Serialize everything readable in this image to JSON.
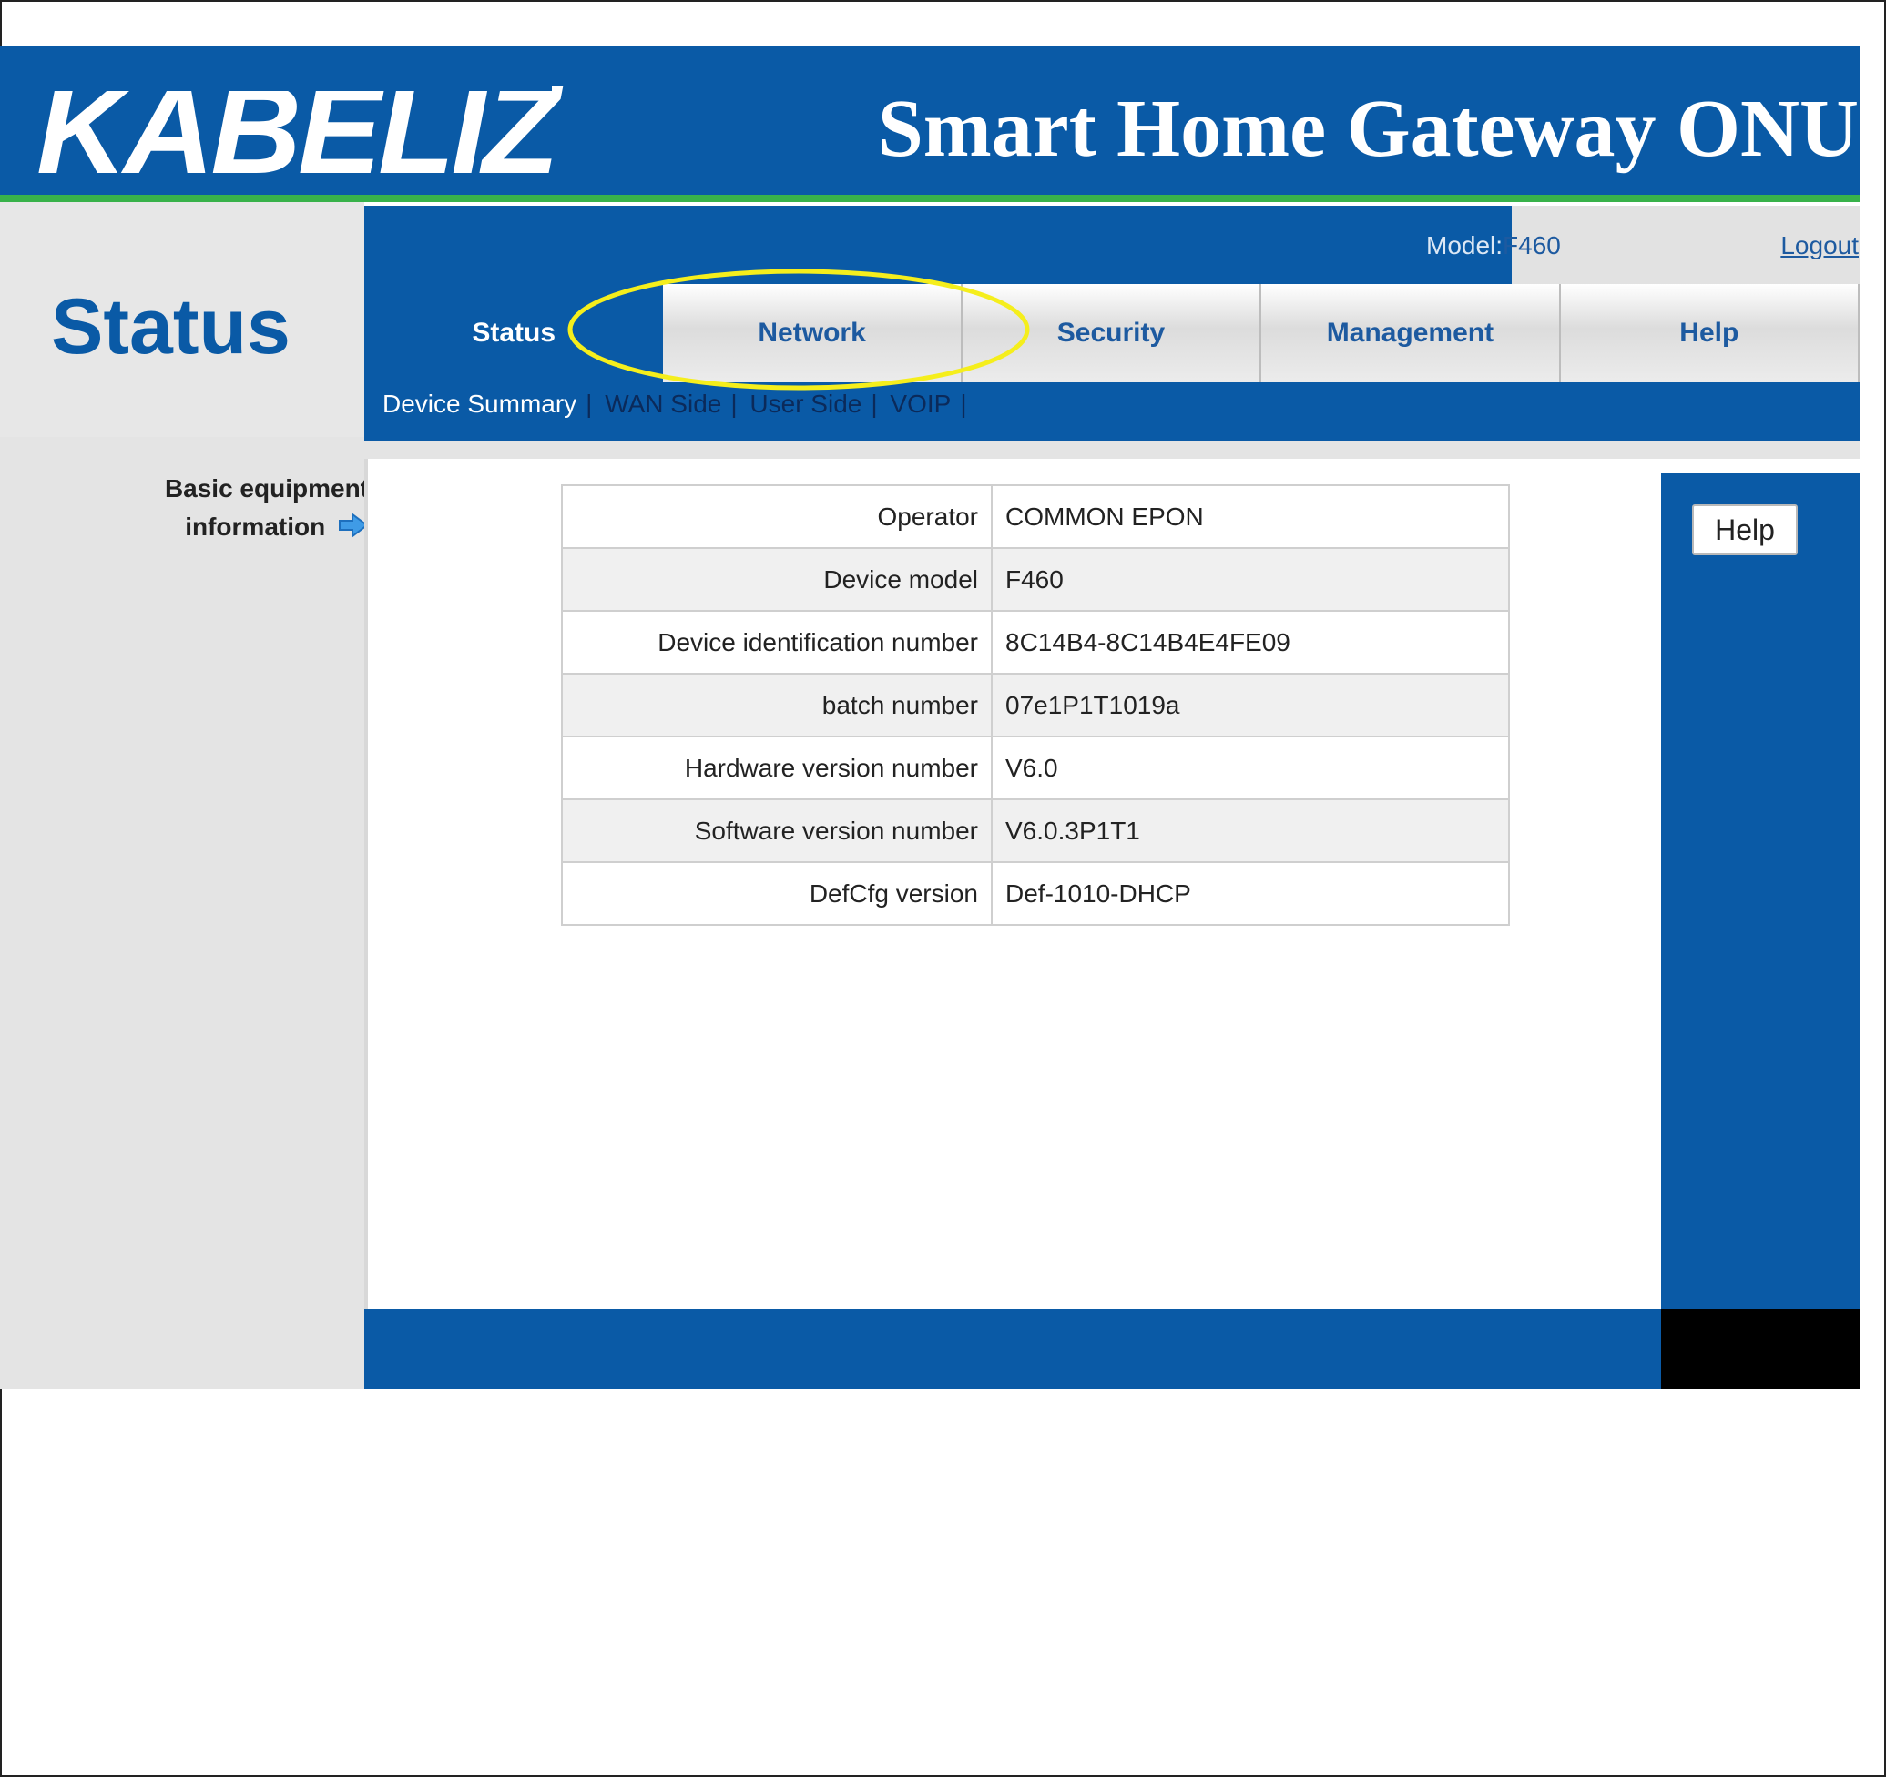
{
  "header": {
    "logo_text": "KABELIZ",
    "title": "Smart Home Gateway ONU",
    "brand_color": "#0a5aa6",
    "accent_color": "#38b24a"
  },
  "page": {
    "heading": "Status"
  },
  "topbar": {
    "model_label": "Model:",
    "model_value": "F460",
    "logout_label": "Logout"
  },
  "tabs": [
    {
      "label": "Status",
      "active": true
    },
    {
      "label": "Network",
      "active": false
    },
    {
      "label": "Security",
      "active": false
    },
    {
      "label": "Management",
      "active": false
    },
    {
      "label": "Help",
      "active": false
    }
  ],
  "subnav": [
    {
      "label": "Device Summary",
      "active": true
    },
    {
      "label": "WAN Side",
      "active": false
    },
    {
      "label": "User Side",
      "active": false
    },
    {
      "label": "VOIP",
      "active": false
    }
  ],
  "sidebar": {
    "link_line1": "Basic equipment",
    "link_line2": "information"
  },
  "device_info": [
    {
      "key": "Operator",
      "value": "COMMON EPON"
    },
    {
      "key": "Device model",
      "value": "F460"
    },
    {
      "key": "Device identification number",
      "value": "8C14B4-8C14B4E4FE09"
    },
    {
      "key": "batch number",
      "value": "07e1P1T1019a"
    },
    {
      "key": "Hardware version number",
      "value": "V6.0"
    },
    {
      "key": "Software version number",
      "value": "V6.0.3P1T1"
    },
    {
      "key": "DefCfg version",
      "value": "Def-1010-DHCP"
    }
  ],
  "help_panel": {
    "button_label": "Help"
  },
  "annotation": {
    "highlight_color": "#f5ee1c",
    "highlight_target": "Network"
  }
}
